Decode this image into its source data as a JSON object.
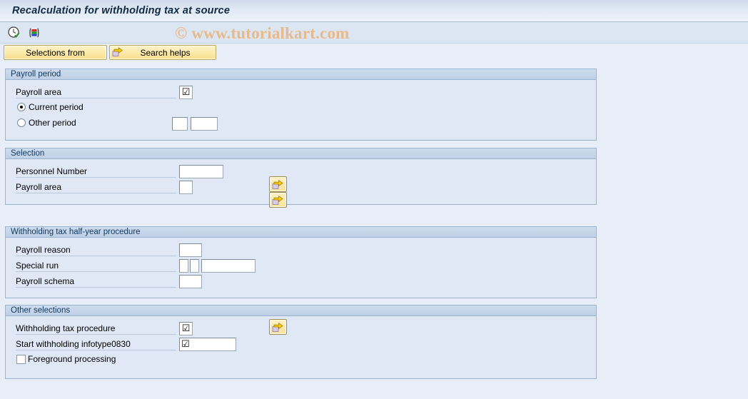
{
  "window": {
    "title": "Recalculation for withholding tax at source"
  },
  "toolbar": {
    "icons": [
      {
        "name": "execute-clock-icon",
        "title": "Execute"
      },
      {
        "name": "variant-bars-icon",
        "title": "Get variant"
      }
    ]
  },
  "watermark": {
    "text": "© www.tutorialkart.com"
  },
  "buttons": {
    "selections_from": "Selections from",
    "search_helps": "Search helps"
  },
  "sections": {
    "payroll_period": {
      "title": "Payroll period",
      "payroll_area_label": "Payroll area",
      "payroll_area_value": "☑",
      "current_period_label": "Current period",
      "other_period_label": "Other period",
      "other_period_value_1": "",
      "other_period_value_2": "",
      "selected_radio": "current"
    },
    "selection": {
      "title": "Selection",
      "personnel_number_label": "Personnel Number",
      "personnel_number_value": "",
      "payroll_area_label": "Payroll area",
      "payroll_area_value": ""
    },
    "withholding_half_year": {
      "title": "Withholding tax half-year procedure",
      "payroll_reason_label": "Payroll reason",
      "payroll_reason_value": "",
      "special_run_label": "Special run",
      "special_run_value_1": "",
      "special_run_value_2": "",
      "special_run_value_3": "",
      "payroll_schema_label": "Payroll schema",
      "payroll_schema_value": ""
    },
    "other_selections": {
      "title": "Other selections",
      "withholding_tax_procedure_label": "Withholding tax procedure",
      "withholding_tax_procedure_value": "☑",
      "start_withholding_infotype_label": "Start withholding infotype0830",
      "start_withholding_infotype_value": "☑",
      "foreground_processing_label": "Foreground processing",
      "foreground_processing_checked": false
    }
  },
  "colors": {
    "page_background": "#e8eef7",
    "panel_background": "#dfe8f4",
    "panel_border": "#9ab3d0",
    "titlebar_text": "#102a43",
    "button_yellow": "#fbe9a8",
    "watermark": "#e8b98a"
  }
}
